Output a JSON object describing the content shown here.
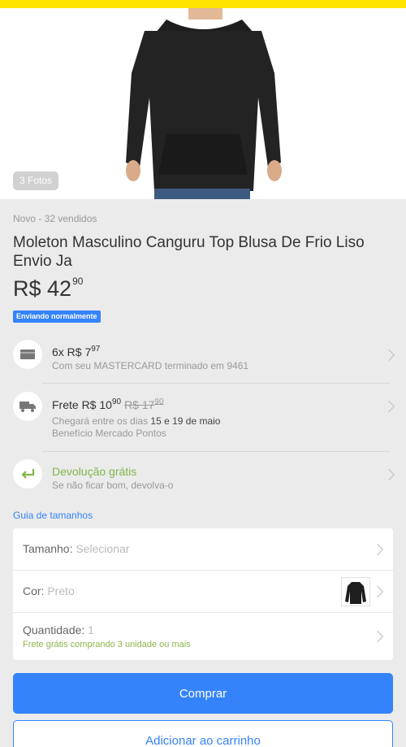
{
  "colors": {
    "header": "#ffe600",
    "primary": "#3483fa",
    "green": "#82b64a"
  },
  "gallery": {
    "photo_count_label": "3 Fotos"
  },
  "product": {
    "meta": "Novo - 32 vendidos",
    "title": "Moleton Masculino Canguru  Top Blusa De Frio Liso Envio Ja",
    "price_main": "R$ 42",
    "price_cents": "90",
    "shipping_badge": "Enviando normalmente"
  },
  "installments": {
    "icon": "credit-card-icon",
    "prefix": "6x R$ 7",
    "cents": "97",
    "subtitle": "Com seu MASTERCARD terminado em 9461"
  },
  "shipping": {
    "icon": "truck-icon",
    "prefix": "Frete R$ 10",
    "cents": "90",
    "old_price": "R$ 17",
    "old_cents": "90",
    "arrival_text": "Chegará entre os dias ",
    "arrival_dates": "15 e 19 de maio",
    "benefit": "Benefício Mercado Pontos"
  },
  "returns": {
    "icon": "return-arrow-icon",
    "title": "Devolução grátis",
    "subtitle": "Se não ficar bom, devolva-o"
  },
  "size_guide_link": "Guia de tamanhos",
  "options": {
    "size_label": "Tamanho: ",
    "size_value": "Selecionar",
    "color_label": "Cor: ",
    "color_value": "Preto",
    "quantity_label": "Quantidade: ",
    "quantity_value": "1",
    "quantity_note": "Frete grátis comprando 3 unidade ou mais"
  },
  "actions": {
    "buy_label": "Comprar",
    "cart_label": "Adicionar ao carrinho"
  }
}
